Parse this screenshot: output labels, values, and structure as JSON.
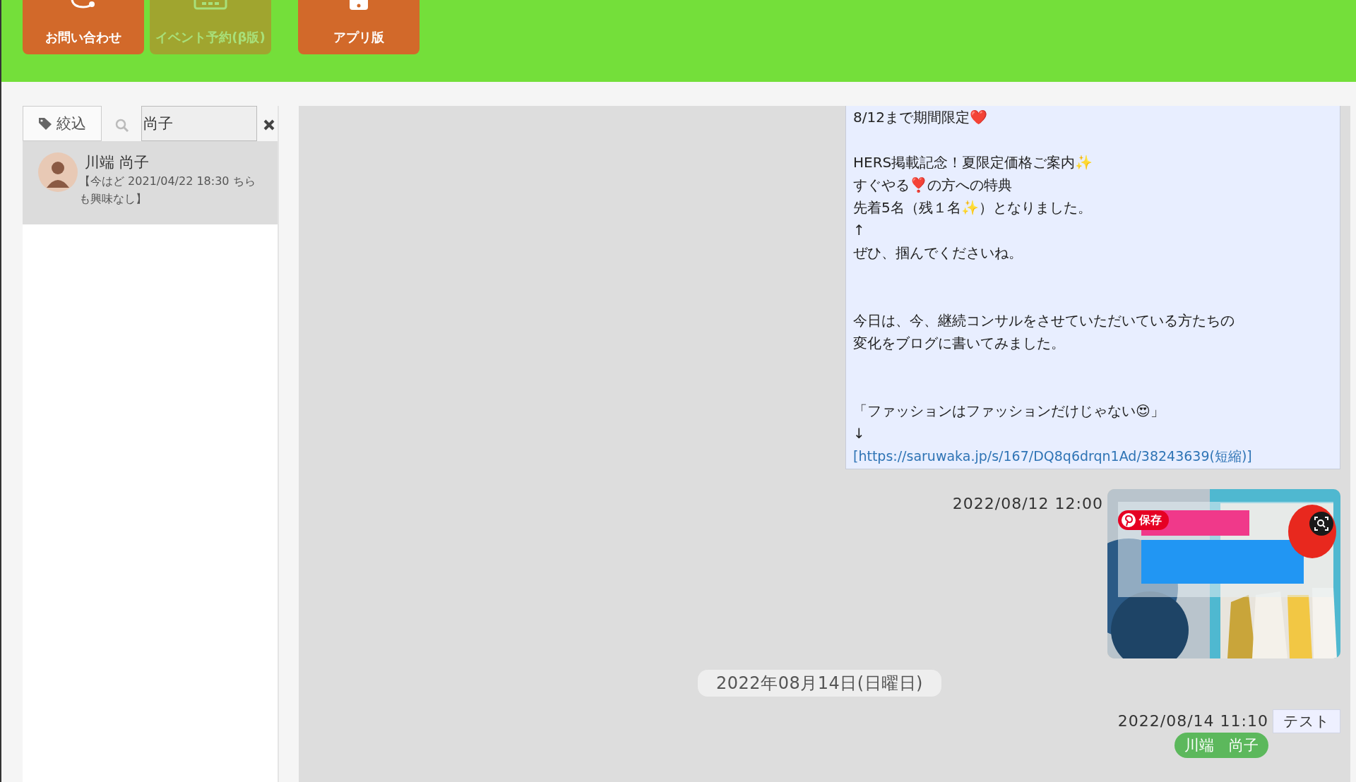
{
  "header": {
    "buttons": [
      {
        "label": "お問い合わせ",
        "disabled": false
      },
      {
        "label": "イベント予約(β版)",
        "disabled": true
      },
      {
        "label": "アプリ版",
        "disabled": false
      }
    ]
  },
  "sidebar": {
    "filter_tab": "絞込",
    "search": {
      "value": "尚子"
    },
    "contacts": [
      {
        "name": "川端 尚子",
        "preview": "【今はど 2021/04/22 18:30 ちらも興味なし】",
        "selected": true
      }
    ]
  },
  "chat": {
    "messages": [
      {
        "kind": "text",
        "paragraphs": [
          {
            "kind": "normal",
            "lines": [
              "8/12まで期間限定❤️"
            ]
          },
          {
            "kind": "normal",
            "lines": [
              "HERS掲載記念！夏限定価格ご案内✨",
              "すぐやる❣️の方への特典",
              "先着5名（残１名✨）となりました。",
              "↑",
              "ぜひ、掴んでくださいね。"
            ]
          },
          {
            "kind": "wide",
            "lines": [
              "今日は、今、継続コンサルをさせていただいている方たちの",
              "変化をブログに書いてみました。"
            ]
          },
          {
            "kind": "wide",
            "lines": [
              "「ファッションはファッションだけじゃない😍」",
              "↓"
            ]
          }
        ],
        "link": "[https://saruwaka.jp/s/167/DQ8q6drqn1Ad/38243639(短縮)]"
      },
      {
        "time": "2022/08/12 12:00",
        "save_button": "保存"
      },
      {
        "kind": "date",
        "label": "2022年08月14日(日曜日)"
      },
      {
        "kind": "short",
        "time": "2022/08/14 11:10",
        "text": "テスト",
        "sender": "川端　尚子"
      }
    ]
  }
}
